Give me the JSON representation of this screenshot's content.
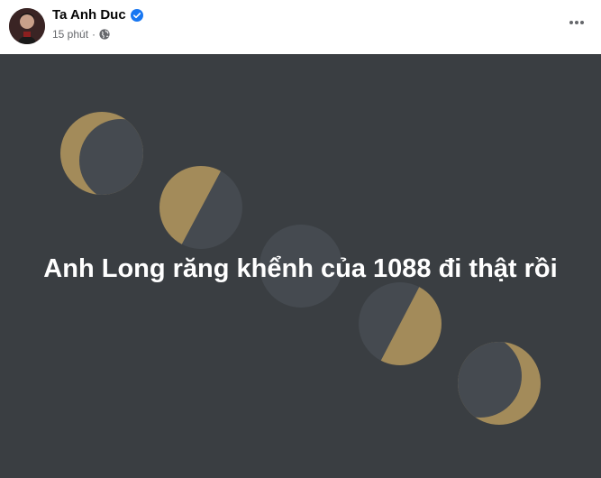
{
  "post": {
    "author_name": "Ta Anh Duc",
    "verified": true,
    "timestamp": "15 phút",
    "separator": "·",
    "privacy_icon": "globe-icon",
    "more_icon": "more-horizontal-icon",
    "text": "Anh Long răng khểnh của 1088 đi thật rồi"
  },
  "colors": {
    "background": "#3a3e42",
    "moon_dark": "#454a50",
    "moon_gold": "#a38b5a",
    "text": "#ffffff",
    "verified": "#1877f2"
  }
}
